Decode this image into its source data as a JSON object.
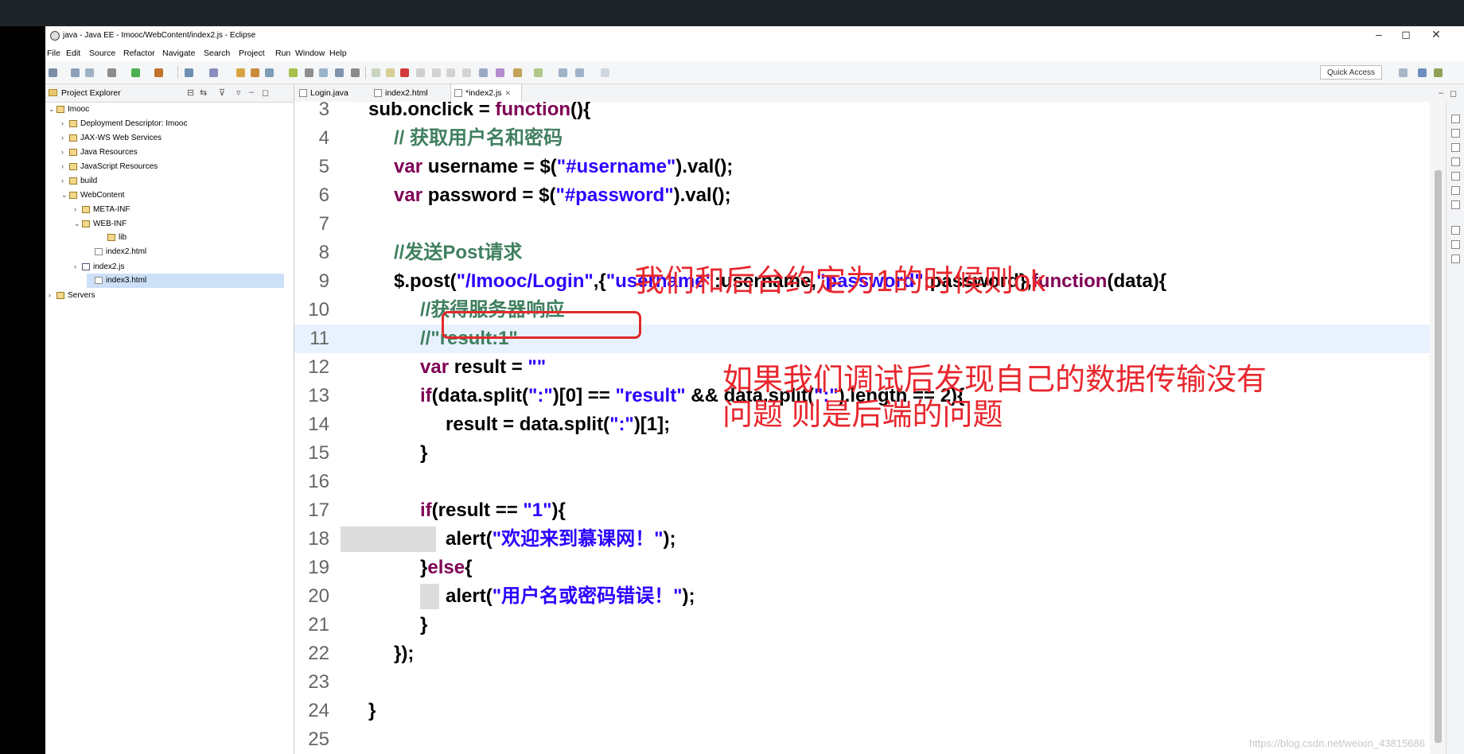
{
  "window": {
    "title": "java - Java EE - Imooc/WebContent/index2.js - Eclipse",
    "controls": [
      "–",
      "◻",
      "✕"
    ]
  },
  "menu": [
    "File",
    "Edit",
    "Source",
    "Refactor",
    "Navigate",
    "Search",
    "Project",
    "Run",
    "Window",
    "Help"
  ],
  "toolbar": {
    "quick_access": "Quick Access"
  },
  "explorer": {
    "title": "Project Explorer",
    "items": [
      {
        "label": "Imooc",
        "arrow": "⌄"
      },
      {
        "label": "Deployment Descriptor: Imooc",
        "arrow": "›"
      },
      {
        "label": "JAX-WS Web Services",
        "arrow": "›"
      },
      {
        "label": "Java Resources",
        "arrow": "›"
      },
      {
        "label": "JavaScript Resources",
        "arrow": "›"
      },
      {
        "label": "build",
        "arrow": "›"
      },
      {
        "label": "WebContent",
        "arrow": "⌄"
      },
      {
        "label": "META-INF",
        "arrow": "›"
      },
      {
        "label": "WEB-INF",
        "arrow": "⌄"
      },
      {
        "label": "lib",
        "arrow": ""
      },
      {
        "label": "index2.html",
        "arrow": ""
      },
      {
        "label": "index2.js",
        "arrow": "›"
      },
      {
        "label": "index3.html",
        "arrow": ""
      },
      {
        "label": "Servers",
        "arrow": "›"
      }
    ]
  },
  "tabs": [
    {
      "label": "Login.java"
    },
    {
      "label": "index2.html"
    },
    {
      "label": "*index2.js"
    }
  ],
  "code_lines": [
    {
      "num": "3",
      "text": "sub.onclick = function(){"
    },
    {
      "num": "4",
      "text": "// 获取用户名和密码"
    },
    {
      "num": "5",
      "text": "var username = $(\"#username\").val();"
    },
    {
      "num": "6",
      "text": "var password = $(\"#password\").val();"
    },
    {
      "num": "7",
      "text": ""
    },
    {
      "num": "8",
      "text": "//发送Post请求"
    },
    {
      "num": "9",
      "text": "$.post(\"/Imooc/Login\",{\"username\":username,\"password\":password},function(data){"
    },
    {
      "num": "10",
      "text": "//获得服务器响应"
    },
    {
      "num": "11",
      "text": "//\"result:1\""
    },
    {
      "num": "12",
      "text": "var result = \"\""
    },
    {
      "num": "13",
      "text": "if(data.split(\":\")[0] == \"result\" && data.split(\":\").length == 2){"
    },
    {
      "num": "14",
      "text": "result = data.split(\":\")[1];"
    },
    {
      "num": "15",
      "text": "}"
    },
    {
      "num": "16",
      "text": ""
    },
    {
      "num": "17",
      "text": "if(result == \"1\"){"
    },
    {
      "num": "18",
      "text": "alert(\"欢迎来到慕课网！\");"
    },
    {
      "num": "19",
      "text": "}else{"
    },
    {
      "num": "20",
      "text": "alert(\"用户名或密码错误！\");"
    },
    {
      "num": "21",
      "text": "}"
    },
    {
      "num": "22",
      "text": "});"
    },
    {
      "num": "23",
      "text": ""
    },
    {
      "num": "24",
      "text": "}"
    },
    {
      "num": "25",
      "text": ""
    }
  ],
  "annotations": {
    "note1": "我们和后台约定为1的时候则ok",
    "note2_line1": "如果我们调试后发现自己的数据传输没有",
    "note2_line2": "问题 则是后端的问题"
  },
  "watermark": "https://blog.csdn.net/weixin_43815686",
  "colors": {
    "keyword": "#7f0055",
    "string": "#2a00ff",
    "comment": "#3f7f5f",
    "annotation": "#e8272e",
    "current_line": "#e8f2fe"
  }
}
